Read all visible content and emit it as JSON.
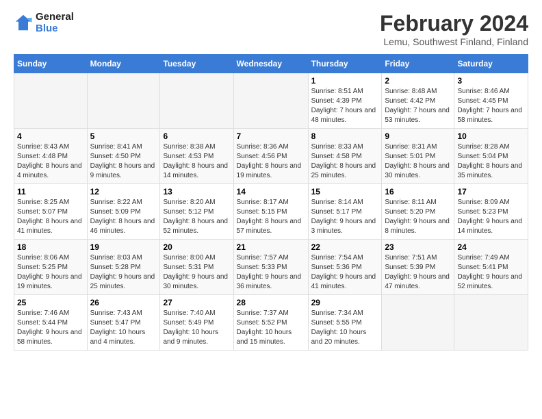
{
  "logo": {
    "line1": "General",
    "line2": "Blue"
  },
  "title": "February 2024",
  "subtitle": "Lemu, Southwest Finland, Finland",
  "weekdays": [
    "Sunday",
    "Monday",
    "Tuesday",
    "Wednesday",
    "Thursday",
    "Friday",
    "Saturday"
  ],
  "weeks": [
    [
      {
        "day": "",
        "info": ""
      },
      {
        "day": "",
        "info": ""
      },
      {
        "day": "",
        "info": ""
      },
      {
        "day": "",
        "info": ""
      },
      {
        "day": "1",
        "info": "Sunrise: 8:51 AM\nSunset: 4:39 PM\nDaylight: 7 hours and 48 minutes."
      },
      {
        "day": "2",
        "info": "Sunrise: 8:48 AM\nSunset: 4:42 PM\nDaylight: 7 hours and 53 minutes."
      },
      {
        "day": "3",
        "info": "Sunrise: 8:46 AM\nSunset: 4:45 PM\nDaylight: 7 hours and 58 minutes."
      }
    ],
    [
      {
        "day": "4",
        "info": "Sunrise: 8:43 AM\nSunset: 4:48 PM\nDaylight: 8 hours and 4 minutes."
      },
      {
        "day": "5",
        "info": "Sunrise: 8:41 AM\nSunset: 4:50 PM\nDaylight: 8 hours and 9 minutes."
      },
      {
        "day": "6",
        "info": "Sunrise: 8:38 AM\nSunset: 4:53 PM\nDaylight: 8 hours and 14 minutes."
      },
      {
        "day": "7",
        "info": "Sunrise: 8:36 AM\nSunset: 4:56 PM\nDaylight: 8 hours and 19 minutes."
      },
      {
        "day": "8",
        "info": "Sunrise: 8:33 AM\nSunset: 4:58 PM\nDaylight: 8 hours and 25 minutes."
      },
      {
        "day": "9",
        "info": "Sunrise: 8:31 AM\nSunset: 5:01 PM\nDaylight: 8 hours and 30 minutes."
      },
      {
        "day": "10",
        "info": "Sunrise: 8:28 AM\nSunset: 5:04 PM\nDaylight: 8 hours and 35 minutes."
      }
    ],
    [
      {
        "day": "11",
        "info": "Sunrise: 8:25 AM\nSunset: 5:07 PM\nDaylight: 8 hours and 41 minutes."
      },
      {
        "day": "12",
        "info": "Sunrise: 8:22 AM\nSunset: 5:09 PM\nDaylight: 8 hours and 46 minutes."
      },
      {
        "day": "13",
        "info": "Sunrise: 8:20 AM\nSunset: 5:12 PM\nDaylight: 8 hours and 52 minutes."
      },
      {
        "day": "14",
        "info": "Sunrise: 8:17 AM\nSunset: 5:15 PM\nDaylight: 8 hours and 57 minutes."
      },
      {
        "day": "15",
        "info": "Sunrise: 8:14 AM\nSunset: 5:17 PM\nDaylight: 9 hours and 3 minutes."
      },
      {
        "day": "16",
        "info": "Sunrise: 8:11 AM\nSunset: 5:20 PM\nDaylight: 9 hours and 8 minutes."
      },
      {
        "day": "17",
        "info": "Sunrise: 8:09 AM\nSunset: 5:23 PM\nDaylight: 9 hours and 14 minutes."
      }
    ],
    [
      {
        "day": "18",
        "info": "Sunrise: 8:06 AM\nSunset: 5:25 PM\nDaylight: 9 hours and 19 minutes."
      },
      {
        "day": "19",
        "info": "Sunrise: 8:03 AM\nSunset: 5:28 PM\nDaylight: 9 hours and 25 minutes."
      },
      {
        "day": "20",
        "info": "Sunrise: 8:00 AM\nSunset: 5:31 PM\nDaylight: 9 hours and 30 minutes."
      },
      {
        "day": "21",
        "info": "Sunrise: 7:57 AM\nSunset: 5:33 PM\nDaylight: 9 hours and 36 minutes."
      },
      {
        "day": "22",
        "info": "Sunrise: 7:54 AM\nSunset: 5:36 PM\nDaylight: 9 hours and 41 minutes."
      },
      {
        "day": "23",
        "info": "Sunrise: 7:51 AM\nSunset: 5:39 PM\nDaylight: 9 hours and 47 minutes."
      },
      {
        "day": "24",
        "info": "Sunrise: 7:49 AM\nSunset: 5:41 PM\nDaylight: 9 hours and 52 minutes."
      }
    ],
    [
      {
        "day": "25",
        "info": "Sunrise: 7:46 AM\nSunset: 5:44 PM\nDaylight: 9 hours and 58 minutes."
      },
      {
        "day": "26",
        "info": "Sunrise: 7:43 AM\nSunset: 5:47 PM\nDaylight: 10 hours and 4 minutes."
      },
      {
        "day": "27",
        "info": "Sunrise: 7:40 AM\nSunset: 5:49 PM\nDaylight: 10 hours and 9 minutes."
      },
      {
        "day": "28",
        "info": "Sunrise: 7:37 AM\nSunset: 5:52 PM\nDaylight: 10 hours and 15 minutes."
      },
      {
        "day": "29",
        "info": "Sunrise: 7:34 AM\nSunset: 5:55 PM\nDaylight: 10 hours and 20 minutes."
      },
      {
        "day": "",
        "info": ""
      },
      {
        "day": "",
        "info": ""
      }
    ]
  ]
}
